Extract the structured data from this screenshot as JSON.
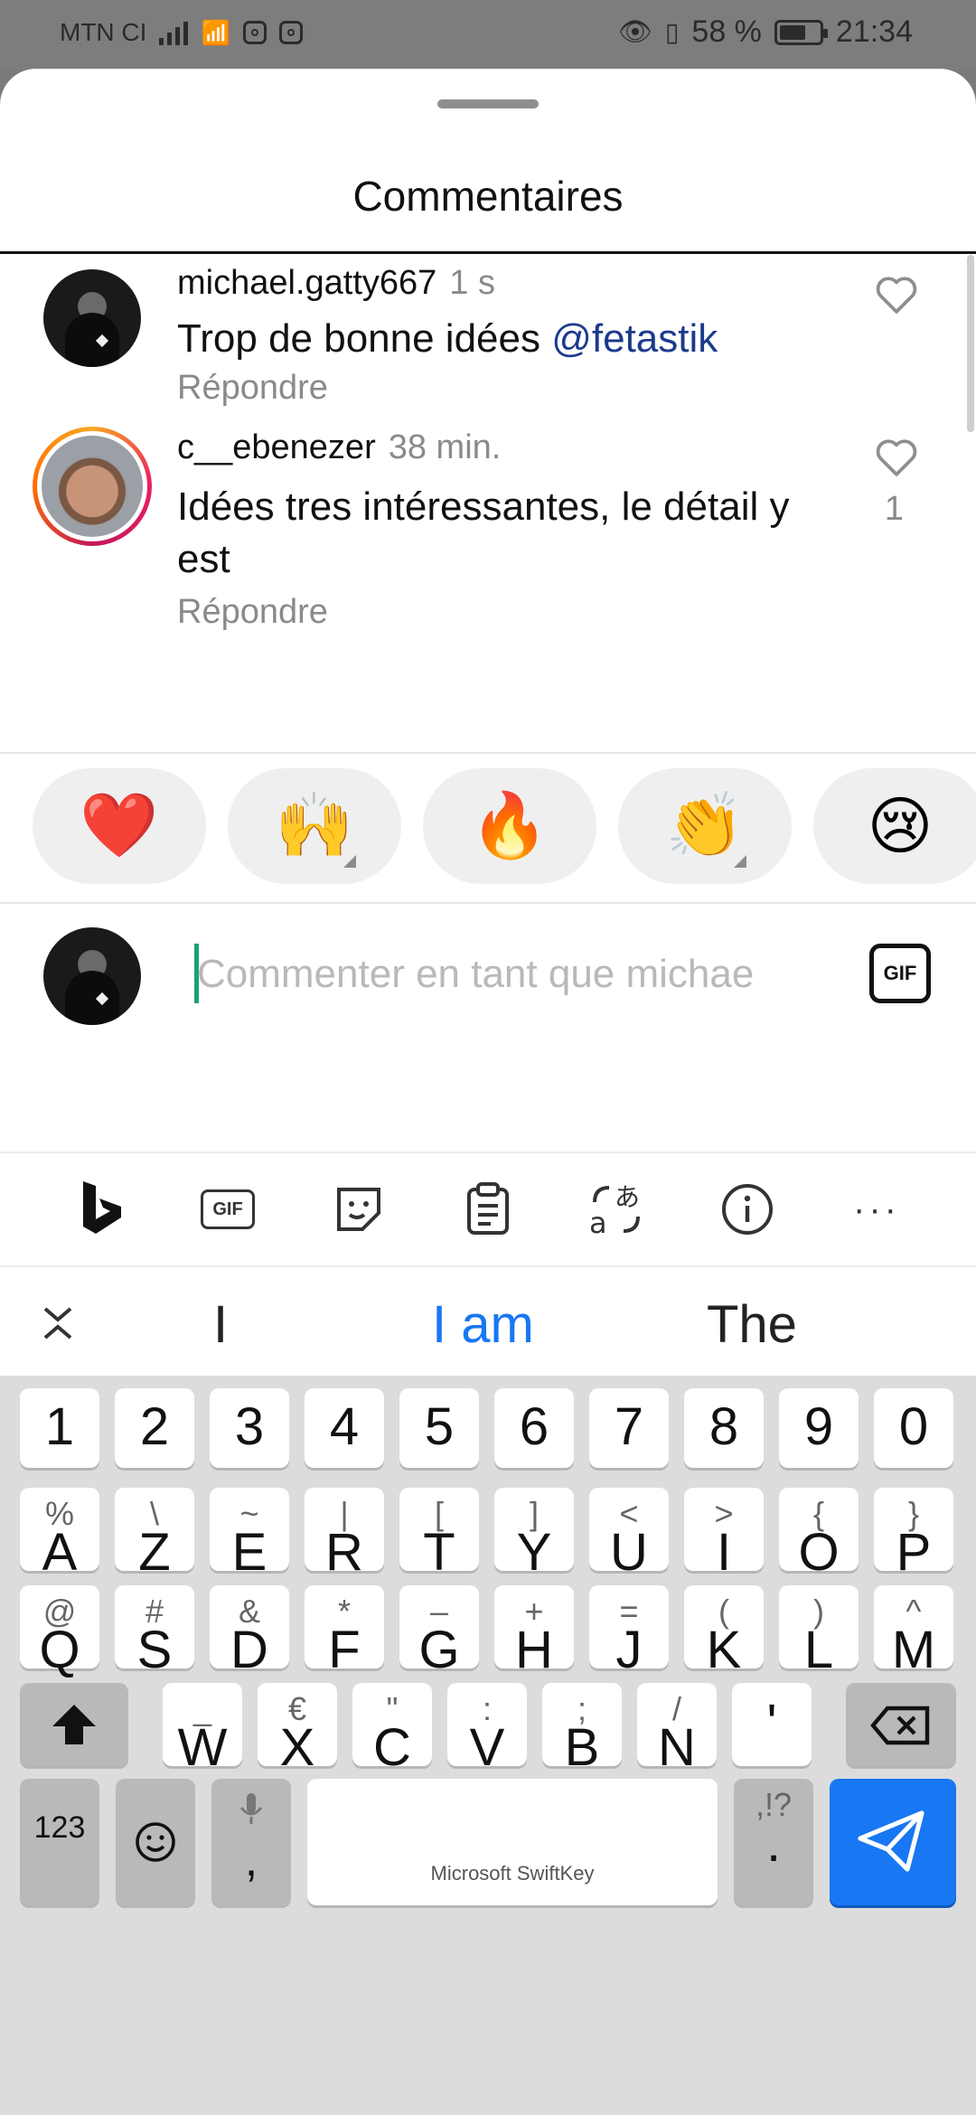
{
  "status_bar": {
    "carrier": "MTN CI",
    "battery": "58 %",
    "time": "21:34"
  },
  "sheet": {
    "title": "Commentaires"
  },
  "comments": [
    {
      "username": "michael.gatty667",
      "time": "1 s",
      "text": "Trop de bonne idées ",
      "mention": "@fetastik",
      "reply": "Répondre",
      "likes": ""
    },
    {
      "username": "c__ebenezer",
      "time": "38 min.",
      "text": "Idées tres intéressantes, le détail y est",
      "reply": "Répondre",
      "likes": "1"
    }
  ],
  "reactions": [
    "❤️",
    "🙌",
    "🔥",
    "👏",
    "😢"
  ],
  "input": {
    "placeholder": "Commenter en tant que michae",
    "gif_label": "GIF"
  },
  "keyboard": {
    "toolbar_gif": "GIF",
    "suggestions": [
      "I",
      "I am",
      "The"
    ],
    "number_row": [
      "1",
      "2",
      "3",
      "4",
      "5",
      "6",
      "7",
      "8",
      "9",
      "0"
    ],
    "row1": [
      {
        "k": "A",
        "a": "%"
      },
      {
        "k": "Z",
        "a": "\\"
      },
      {
        "k": "E",
        "a": "~"
      },
      {
        "k": "R",
        "a": "|"
      },
      {
        "k": "T",
        "a": "["
      },
      {
        "k": "Y",
        "a": "]"
      },
      {
        "k": "U",
        "a": "<"
      },
      {
        "k": "I",
        "a": ">"
      },
      {
        "k": "O",
        "a": "{"
      },
      {
        "k": "P",
        "a": "}"
      }
    ],
    "row2": [
      {
        "k": "Q",
        "a": "@"
      },
      {
        "k": "S",
        "a": "#"
      },
      {
        "k": "D",
        "a": "&"
      },
      {
        "k": "F",
        "a": "*"
      },
      {
        "k": "G",
        "a": "–"
      },
      {
        "k": "H",
        "a": "+"
      },
      {
        "k": "J",
        "a": "="
      },
      {
        "k": "K",
        "a": "("
      },
      {
        "k": "L",
        "a": ")"
      },
      {
        "k": "M",
        "a": "^"
      }
    ],
    "row3": [
      {
        "k": "W",
        "a": "_"
      },
      {
        "k": "X",
        "a": "€"
      },
      {
        "k": "C",
        "a": "\""
      },
      {
        "k": "V",
        "a": ":"
      },
      {
        "k": "B",
        "a": ";"
      },
      {
        "k": "N",
        "a": "/"
      },
      {
        "k": "'",
        "a": ""
      }
    ],
    "num_key": "123",
    "comma": ",",
    "space_label": "Microsoft SwiftKey",
    "period": ".",
    "period_alt": ",!?"
  }
}
